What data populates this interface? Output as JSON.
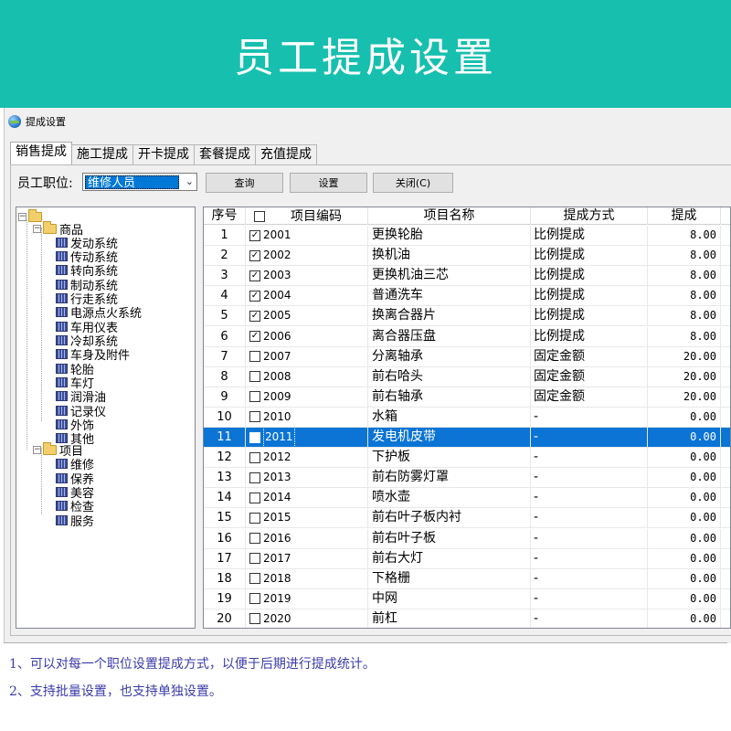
{
  "banner": {
    "title": "员工提成设置"
  },
  "window": {
    "title": "提成设置",
    "icon": "globe-icon"
  },
  "tabs": [
    {
      "label": "销售提成",
      "active": true
    },
    {
      "label": "施工提成",
      "active": false
    },
    {
      "label": "开卡提成",
      "active": false
    },
    {
      "label": "套餐提成",
      "active": false
    },
    {
      "label": "充值提成",
      "active": false
    }
  ],
  "toolbar": {
    "position_label": "员工职位:",
    "position_value": "维修人员",
    "query_label": "查询",
    "set_label": "设置",
    "close_label": "关闭(C)"
  },
  "tree": {
    "groups": [
      {
        "label": "商品",
        "children": [
          "发动系统",
          "传动系统",
          "转向系统",
          "制动系统",
          "行走系统",
          "电源点火系统",
          "车用仪表",
          "冷却系统",
          "车身及附件",
          "轮胎",
          "车灯",
          "润滑油",
          "记录仪",
          "外饰",
          "其他"
        ]
      },
      {
        "label": "项目",
        "children": [
          "维修",
          "保养",
          "美容",
          "检查",
          "服务"
        ]
      }
    ]
  },
  "grid": {
    "headers": {
      "no": "序号",
      "code": "项目编码",
      "name": "项目名称",
      "mode": "提成方式",
      "amount": "提成"
    },
    "rows": [
      {
        "no": "1",
        "checked": true,
        "code": "2001",
        "name": "更换轮胎",
        "mode": "比例提成",
        "amount": "8.00"
      },
      {
        "no": "2",
        "checked": true,
        "code": "2002",
        "name": "换机油",
        "mode": "比例提成",
        "amount": "8.00"
      },
      {
        "no": "3",
        "checked": true,
        "code": "2003",
        "name": "更换机油三芯",
        "mode": "比例提成",
        "amount": "8.00"
      },
      {
        "no": "4",
        "checked": true,
        "code": "2004",
        "name": "普通洗车",
        "mode": "比例提成",
        "amount": "8.00"
      },
      {
        "no": "5",
        "checked": true,
        "code": "2005",
        "name": "换离合器片",
        "mode": "比例提成",
        "amount": "8.00"
      },
      {
        "no": "6",
        "checked": true,
        "code": "2006",
        "name": "离合器压盘",
        "mode": "比例提成",
        "amount": "8.00"
      },
      {
        "no": "7",
        "checked": false,
        "code": "2007",
        "name": "分离轴承",
        "mode": "固定金额",
        "amount": "20.00"
      },
      {
        "no": "8",
        "checked": false,
        "code": "2008",
        "name": "前右哈头",
        "mode": "固定金额",
        "amount": "20.00"
      },
      {
        "no": "9",
        "checked": false,
        "code": "2009",
        "name": "前右轴承",
        "mode": "固定金额",
        "amount": "20.00"
      },
      {
        "no": "10",
        "checked": false,
        "code": "2010",
        "name": "水箱",
        "mode": "-",
        "amount": "0.00"
      },
      {
        "no": "11",
        "checked": false,
        "code": "2011",
        "name": "发电机皮带",
        "mode": "-",
        "amount": "0.00",
        "selected": true
      },
      {
        "no": "12",
        "checked": false,
        "code": "2012",
        "name": "下护板",
        "mode": "-",
        "amount": "0.00"
      },
      {
        "no": "13",
        "checked": false,
        "code": "2013",
        "name": "前右防雾灯罩",
        "mode": "-",
        "amount": "0.00"
      },
      {
        "no": "14",
        "checked": false,
        "code": "2014",
        "name": "喷水壶",
        "mode": "-",
        "amount": "0.00"
      },
      {
        "no": "15",
        "checked": false,
        "code": "2015",
        "name": "前右叶子板内衬",
        "mode": "-",
        "amount": "0.00"
      },
      {
        "no": "16",
        "checked": false,
        "code": "2016",
        "name": "前右叶子板",
        "mode": "-",
        "amount": "0.00"
      },
      {
        "no": "17",
        "checked": false,
        "code": "2017",
        "name": "前右大灯",
        "mode": "-",
        "amount": "0.00"
      },
      {
        "no": "18",
        "checked": false,
        "code": "2018",
        "name": "下格栅",
        "mode": "-",
        "amount": "0.00"
      },
      {
        "no": "19",
        "checked": false,
        "code": "2019",
        "name": "中网",
        "mode": "-",
        "amount": "0.00"
      },
      {
        "no": "20",
        "checked": false,
        "code": "2020",
        "name": "前杠",
        "mode": "-",
        "amount": "0.00"
      }
    ]
  },
  "notes": [
    "1、可以对每一个职位设置提成方式，以便于后期进行提成统计。",
    "2、支持批量设置，也支持单独设置。"
  ],
  "colors": {
    "banner": "#17bfae",
    "selection": "#0b74d5",
    "note_text": "#3a3aa8"
  }
}
